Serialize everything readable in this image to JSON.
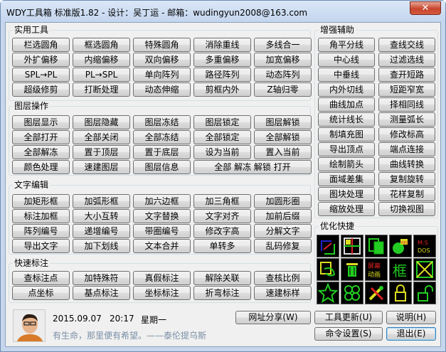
{
  "window": {
    "title": "WDY工具箱 标准版1.82 - 设计：吴丁运 - 邮箱：wudingyun2008@163.com",
    "close": "✕"
  },
  "groups": {
    "practical": "实用工具",
    "layer": "图层操作",
    "text": "文字编辑",
    "dim": "快速标注",
    "enhance": "增强辅助",
    "quick": "优化快捷"
  },
  "practical_buttons": [
    "栏选圆角",
    "框选圆角",
    "特殊圆角",
    "消除重线",
    "多线合一",
    "外扩偏移",
    "内缩偏移",
    "双向偏移",
    "多重偏移",
    "加宽偏移",
    "SPL→PL",
    "PL→SPL",
    "单向阵列",
    "路径阵列",
    "动态阵列",
    "超级修剪",
    "打断处理",
    "动态伸缩",
    "剪框内外",
    "Z轴归零"
  ],
  "layer_buttons": [
    "图层显示",
    "图层隐藏",
    "图层冻结",
    "图层锁定",
    "图层解锁",
    "全部打开",
    "全部关闭",
    "全部冻结",
    "全部锁定",
    "全部解锁",
    "全部解冻",
    "置于顶层",
    "置于底层",
    "设为当前",
    "置入当前",
    "颜色处理",
    "速建图层",
    "图层信息",
    "全部 解冻 解锁 打开"
  ],
  "text_buttons": [
    "加矩形框",
    "加弧形框",
    "加六边框",
    "加三角框",
    "加圆形圈",
    "标注加框",
    "大小互转",
    "文字替换",
    "文字对齐",
    "加前后缀",
    "阵列编号",
    "递增编号",
    "带圈编号",
    "修改字高",
    "分解文字",
    "导出文字",
    "加下划线",
    "文本合并",
    "单转多",
    "乱码修复"
  ],
  "dim_buttons": [
    "查标注点",
    "加特殊符",
    "真假标注",
    "解除关联",
    "查核比例",
    "点坐标",
    "基点标注",
    "坐标标注",
    "折弯标注",
    "速建标样"
  ],
  "enhance_buttons": [
    "角平分线",
    "查线交线",
    "中心线",
    "过滤选线",
    "中垂线",
    "查开短路",
    "内外切线",
    "短距窄宽",
    "曲线加点",
    "择相同线",
    "统计线长",
    "测量弧长",
    "制填充图",
    "修改标高",
    "导出顶点",
    "端点连接",
    "绘制箭头",
    "曲线转换",
    "面域差集",
    "复制旋转",
    "图块处理",
    "花样复制",
    "缩放处理",
    "切换视图"
  ],
  "quick_icons": [
    "select-icon",
    "grid-icon",
    "copy-icon",
    "paint-icon",
    "text-ms-dos-icon",
    "lasso-icon",
    "trash-icon",
    "screen-text-icon",
    "frame-text-icon",
    "cross-icon",
    "star-icon",
    "balls-icon",
    "tools-icon",
    "lock-icon",
    "unlock-icon"
  ],
  "quick_text": {
    "reg": "REG",
    "ms": "M:S",
    "dos": "DOS",
    "screen": "屏幕",
    "anim": "动画",
    "frame": "框"
  },
  "footer": {
    "date": "2015.09.07",
    "time": "20:17",
    "weekday": "星期一",
    "motto": "有生命，那里便有希望。——泰伦提乌斯",
    "share": "网址分享(W)",
    "update": "工具更新(U)",
    "help": "说明(H)",
    "settings": "命令设置(S)",
    "exit": "退出(E)"
  }
}
